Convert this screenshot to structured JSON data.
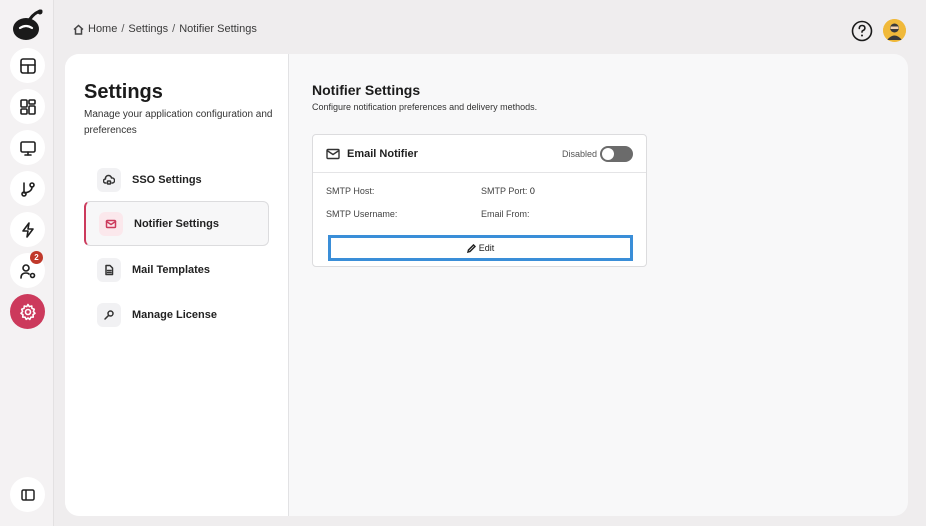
{
  "breadcrumb": {
    "items": [
      "Home",
      "Settings",
      "Notifier Settings"
    ],
    "separator": "/"
  },
  "header": {
    "help_icon": "help-circle-icon",
    "avatar_icon": "user-avatar"
  },
  "rail": {
    "items": [
      {
        "name": "dashboard-icon"
      },
      {
        "name": "grid-icon"
      },
      {
        "name": "monitor-icon"
      },
      {
        "name": "git-branch-icon"
      },
      {
        "name": "lightning-icon"
      },
      {
        "name": "user-settings-icon",
        "badge": "2"
      },
      {
        "name": "gear-icon",
        "active": true
      }
    ],
    "collapse_icon": "sidebar-toggle-icon",
    "accent": "#cc3a5c"
  },
  "sidebar": {
    "title": "Settings",
    "description": "Manage your application configuration and preferences",
    "items": [
      {
        "label": "SSO Settings",
        "icon": "cloud-lock-icon"
      },
      {
        "label": "Notifier Settings",
        "icon": "mail-icon",
        "active": true
      },
      {
        "label": "Mail Templates",
        "icon": "document-icon"
      },
      {
        "label": "Manage License",
        "icon": "key-icon"
      }
    ]
  },
  "main": {
    "title": "Notifier Settings",
    "description": "Configure notification preferences and delivery methods.",
    "card": {
      "title": "Email Notifier",
      "status": "Disabled",
      "enabled": false,
      "fields": {
        "smtp_host": "SMTP Host:",
        "smtp_port": "SMTP Port:",
        "smtp_port_value": "0",
        "smtp_username": "SMTP Username:",
        "email_from": "Email From:"
      },
      "edit_label": "Edit"
    }
  }
}
